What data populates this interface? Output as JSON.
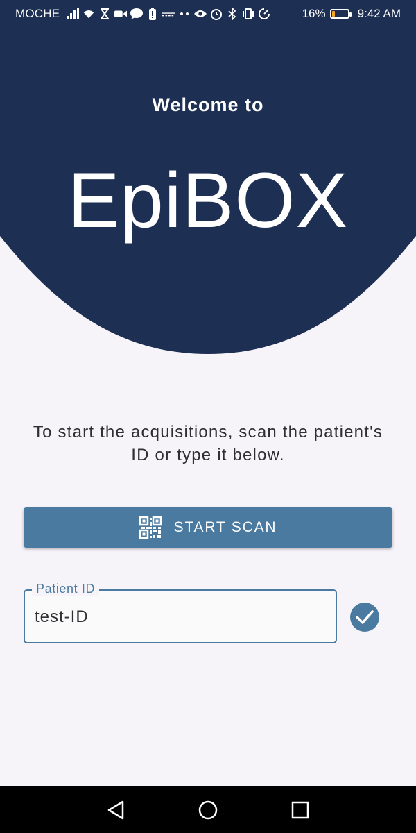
{
  "status_bar": {
    "carrier": "MOCHE",
    "icons": [
      "signal-icon",
      "wifi-icon",
      "hourglass-icon",
      "video-icon",
      "chat-icon",
      "battery-alert-icon",
      "speed-icon",
      "more-icon",
      "eye-icon",
      "alarm-icon",
      "bluetooth-icon",
      "vibrate-icon",
      "data-saver-icon"
    ],
    "battery_percent": "16%",
    "battery_level": 0.16,
    "time": "9:42 AM"
  },
  "header": {
    "welcome_text": "Welcome to",
    "app_name": "EpiBOX",
    "background_color": "#1d2f52"
  },
  "main": {
    "instructions": "To start the acquisitions, scan the patient's ID or type it below.",
    "scan_button": {
      "label": "START SCAN",
      "icon": "qr-code-icon"
    },
    "patient_field": {
      "label": "Patient ID",
      "value": "test-ID"
    },
    "confirm_icon": "check-icon",
    "accent_color": "#4a7aa0"
  },
  "nav_bar": {
    "buttons": [
      "back-icon",
      "home-icon",
      "recents-icon"
    ]
  }
}
